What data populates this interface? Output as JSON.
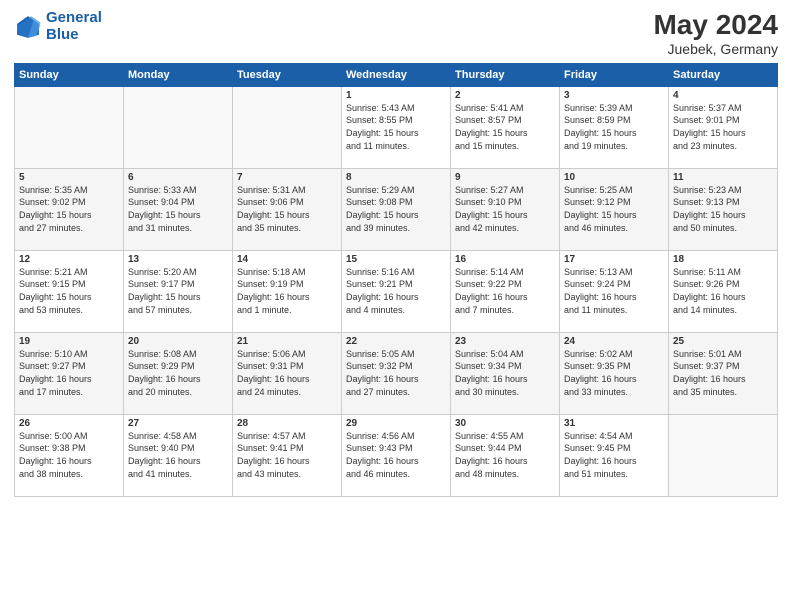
{
  "header": {
    "logo_line1": "General",
    "logo_line2": "Blue",
    "main_title": "May 2024",
    "subtitle": "Juebek, Germany"
  },
  "days_of_week": [
    "Sunday",
    "Monday",
    "Tuesday",
    "Wednesday",
    "Thursday",
    "Friday",
    "Saturday"
  ],
  "weeks": [
    [
      {
        "day": "",
        "text": ""
      },
      {
        "day": "",
        "text": ""
      },
      {
        "day": "",
        "text": ""
      },
      {
        "day": "1",
        "text": "Sunrise: 5:43 AM\nSunset: 8:55 PM\nDaylight: 15 hours\nand 11 minutes."
      },
      {
        "day": "2",
        "text": "Sunrise: 5:41 AM\nSunset: 8:57 PM\nDaylight: 15 hours\nand 15 minutes."
      },
      {
        "day": "3",
        "text": "Sunrise: 5:39 AM\nSunset: 8:59 PM\nDaylight: 15 hours\nand 19 minutes."
      },
      {
        "day": "4",
        "text": "Sunrise: 5:37 AM\nSunset: 9:01 PM\nDaylight: 15 hours\nand 23 minutes."
      }
    ],
    [
      {
        "day": "5",
        "text": "Sunrise: 5:35 AM\nSunset: 9:02 PM\nDaylight: 15 hours\nand 27 minutes."
      },
      {
        "day": "6",
        "text": "Sunrise: 5:33 AM\nSunset: 9:04 PM\nDaylight: 15 hours\nand 31 minutes."
      },
      {
        "day": "7",
        "text": "Sunrise: 5:31 AM\nSunset: 9:06 PM\nDaylight: 15 hours\nand 35 minutes."
      },
      {
        "day": "8",
        "text": "Sunrise: 5:29 AM\nSunset: 9:08 PM\nDaylight: 15 hours\nand 39 minutes."
      },
      {
        "day": "9",
        "text": "Sunrise: 5:27 AM\nSunset: 9:10 PM\nDaylight: 15 hours\nand 42 minutes."
      },
      {
        "day": "10",
        "text": "Sunrise: 5:25 AM\nSunset: 9:12 PM\nDaylight: 15 hours\nand 46 minutes."
      },
      {
        "day": "11",
        "text": "Sunrise: 5:23 AM\nSunset: 9:13 PM\nDaylight: 15 hours\nand 50 minutes."
      }
    ],
    [
      {
        "day": "12",
        "text": "Sunrise: 5:21 AM\nSunset: 9:15 PM\nDaylight: 15 hours\nand 53 minutes."
      },
      {
        "day": "13",
        "text": "Sunrise: 5:20 AM\nSunset: 9:17 PM\nDaylight: 15 hours\nand 57 minutes."
      },
      {
        "day": "14",
        "text": "Sunrise: 5:18 AM\nSunset: 9:19 PM\nDaylight: 16 hours\nand 1 minute."
      },
      {
        "day": "15",
        "text": "Sunrise: 5:16 AM\nSunset: 9:21 PM\nDaylight: 16 hours\nand 4 minutes."
      },
      {
        "day": "16",
        "text": "Sunrise: 5:14 AM\nSunset: 9:22 PM\nDaylight: 16 hours\nand 7 minutes."
      },
      {
        "day": "17",
        "text": "Sunrise: 5:13 AM\nSunset: 9:24 PM\nDaylight: 16 hours\nand 11 minutes."
      },
      {
        "day": "18",
        "text": "Sunrise: 5:11 AM\nSunset: 9:26 PM\nDaylight: 16 hours\nand 14 minutes."
      }
    ],
    [
      {
        "day": "19",
        "text": "Sunrise: 5:10 AM\nSunset: 9:27 PM\nDaylight: 16 hours\nand 17 minutes."
      },
      {
        "day": "20",
        "text": "Sunrise: 5:08 AM\nSunset: 9:29 PM\nDaylight: 16 hours\nand 20 minutes."
      },
      {
        "day": "21",
        "text": "Sunrise: 5:06 AM\nSunset: 9:31 PM\nDaylight: 16 hours\nand 24 minutes."
      },
      {
        "day": "22",
        "text": "Sunrise: 5:05 AM\nSunset: 9:32 PM\nDaylight: 16 hours\nand 27 minutes."
      },
      {
        "day": "23",
        "text": "Sunrise: 5:04 AM\nSunset: 9:34 PM\nDaylight: 16 hours\nand 30 minutes."
      },
      {
        "day": "24",
        "text": "Sunrise: 5:02 AM\nSunset: 9:35 PM\nDaylight: 16 hours\nand 33 minutes."
      },
      {
        "day": "25",
        "text": "Sunrise: 5:01 AM\nSunset: 9:37 PM\nDaylight: 16 hours\nand 35 minutes."
      }
    ],
    [
      {
        "day": "26",
        "text": "Sunrise: 5:00 AM\nSunset: 9:38 PM\nDaylight: 16 hours\nand 38 minutes."
      },
      {
        "day": "27",
        "text": "Sunrise: 4:58 AM\nSunset: 9:40 PM\nDaylight: 16 hours\nand 41 minutes."
      },
      {
        "day": "28",
        "text": "Sunrise: 4:57 AM\nSunset: 9:41 PM\nDaylight: 16 hours\nand 43 minutes."
      },
      {
        "day": "29",
        "text": "Sunrise: 4:56 AM\nSunset: 9:43 PM\nDaylight: 16 hours\nand 46 minutes."
      },
      {
        "day": "30",
        "text": "Sunrise: 4:55 AM\nSunset: 9:44 PM\nDaylight: 16 hours\nand 48 minutes."
      },
      {
        "day": "31",
        "text": "Sunrise: 4:54 AM\nSunset: 9:45 PM\nDaylight: 16 hours\nand 51 minutes."
      },
      {
        "day": "",
        "text": ""
      }
    ]
  ]
}
